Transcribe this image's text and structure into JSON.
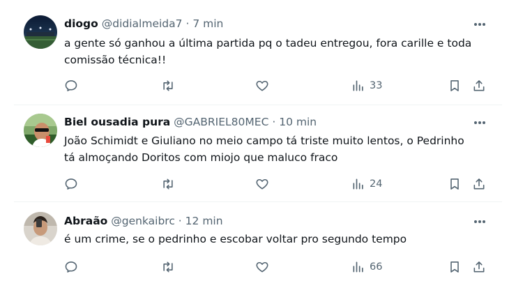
{
  "tweets": [
    {
      "name": "diogo",
      "handle": "@didialmeida7",
      "separator": "·",
      "time": "7 min",
      "text_lines": [
        "a gente só ganhou a última partida pq o tadeu entregou, fora carille e toda",
        "comissão técnica!!"
      ],
      "views": "33",
      "avatar": "night-stadium"
    },
    {
      "name": "Biel ousadia pura",
      "handle": "@GABRIEL80MEC",
      "separator": "·",
      "time": "10 min",
      "text_lines": [
        "João Schimidt e Giuliano no meio campo tá triste muito lentos, o Pedrinho",
        "tá almoçando Doritos com miojo que maluco fraco"
      ],
      "views": "24",
      "avatar": "person-sunglasses"
    },
    {
      "name": "Abraão",
      "handle": "@genkaibrc",
      "separator": "·",
      "time": "12 min",
      "text_lines": [
        "é um crime, se o pedrinho e escobar voltar pro segundo tempo"
      ],
      "views": "66",
      "avatar": "person-selfie"
    }
  ],
  "icons": {
    "reply": "reply-icon",
    "retweet": "retweet-icon",
    "like": "like-icon",
    "views": "views-icon",
    "bookmark": "bookmark-icon",
    "share": "share-icon",
    "more": "more-icon"
  },
  "colors": {
    "text": "#0f1419",
    "secondary": "#536471",
    "divider": "#eff3f4"
  }
}
